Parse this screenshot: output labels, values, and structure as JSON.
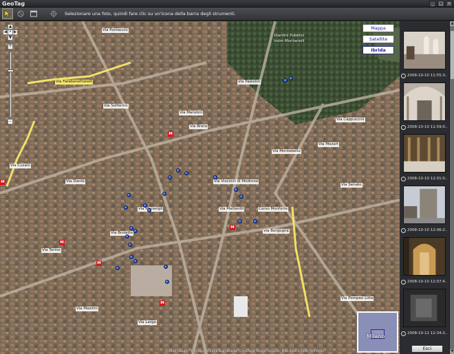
{
  "window": {
    "title": "GeoTag"
  },
  "toolbar": {
    "message": "Selezionare una foto, quindi fare clic su un'icona della barra degli strumenti."
  },
  "map": {
    "types": [
      {
        "label": "Mappa",
        "selected": false
      },
      {
        "label": "Satellite",
        "selected": false
      },
      {
        "label": "Ibrida",
        "selected": true
      }
    ],
    "streets": [
      {
        "t": "Via Pontaccio"
      },
      {
        "t": "Via Fatebenefratelli"
      },
      {
        "t": "Via Palestro"
      },
      {
        "t": "Via Manzoni"
      },
      {
        "t": "Via Borgogna"
      },
      {
        "t": "Via Dante"
      },
      {
        "t": "Via Mazzini"
      },
      {
        "t": "Via Cusani"
      },
      {
        "t": "Via Torino"
      },
      {
        "t": "Via Larga"
      },
      {
        "t": "Via Mozart"
      },
      {
        "t": "Via Cappuccini"
      },
      {
        "t": "Via Senato"
      },
      {
        "t": "Corso Monforte"
      },
      {
        "t": "Via Brera"
      },
      {
        "t": "Via Solferino"
      },
      {
        "t": "Via Visconti di Modrone"
      },
      {
        "t": "Via Meravigli"
      },
      {
        "t": "Via Montebello"
      },
      {
        "t": "Via Broletto"
      },
      {
        "t": "Via Matteotti"
      },
      {
        "t": "Via Pompeo Litta"
      }
    ],
    "pois": [
      {
        "t": "Giardini Pubblici"
      },
      {
        "t": "Indro Montanelli"
      }
    ],
    "minimap_label": "Milano",
    "copyright": "©2008 Google - Immagini ©2008 DigitalGlobe, Cnes/Spot Image, GeoEye, Map data ©2008 Tele Atlas"
  },
  "photos": [
    {
      "label": "2008-10-10 11:55:3..."
    },
    {
      "label": "2008-10-10 11:59:0..."
    },
    {
      "label": "2008-10-10 12:01:0..."
    },
    {
      "label": "2008-10-10 12:06:2..."
    },
    {
      "label": "2008-10-10 12:07:4..."
    },
    {
      "label": "2008-10-12 12:34:2..."
    }
  ],
  "buttons": {
    "exit": "Esci"
  }
}
